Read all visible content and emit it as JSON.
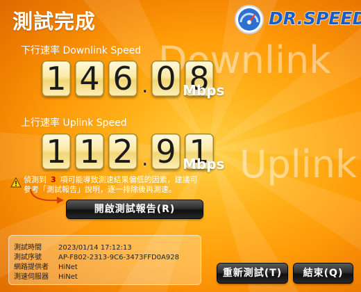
{
  "title": "測試完成",
  "logo": {
    "text": "DR.SPEED"
  },
  "watermarks": {
    "downlink": "Downlink",
    "uplink": "Uplink"
  },
  "download": {
    "label": "下行速率 Downlink Speed",
    "digits": [
      "1",
      "4",
      "6",
      ".",
      "0",
      "8"
    ],
    "unit": "Mbps"
  },
  "upload": {
    "label": "上行速率 Uplink Speed",
    "digits": [
      "1",
      "1",
      "2",
      ".",
      "9",
      "1"
    ],
    "unit": "Mbps"
  },
  "warning": {
    "prefix": "偵測到",
    "count": "3",
    "line1_suffix": "項可能導致測速結果偏低的因素，建議可",
    "line2": "參考「測試報告」說明，逐一排除後再測速。"
  },
  "buttons": {
    "report": "開啟測試報告(R)",
    "retest": "重新測試(T)",
    "quit": "結束(Q)"
  },
  "info": {
    "time_label": "測試時間",
    "time": "2023/01/14 17:12:13",
    "serial_label": "測試序號",
    "serial": "AP-F802-2313-9C6-3473FFD0A928",
    "isp_label": "網路提供者",
    "isp": "HiNet",
    "server_label": "測速伺服器",
    "server": "HiNet"
  },
  "colors": {
    "accent": "#ff9a08",
    "logo_blue": "#1d5dc0",
    "warning_number": "#c00000"
  }
}
